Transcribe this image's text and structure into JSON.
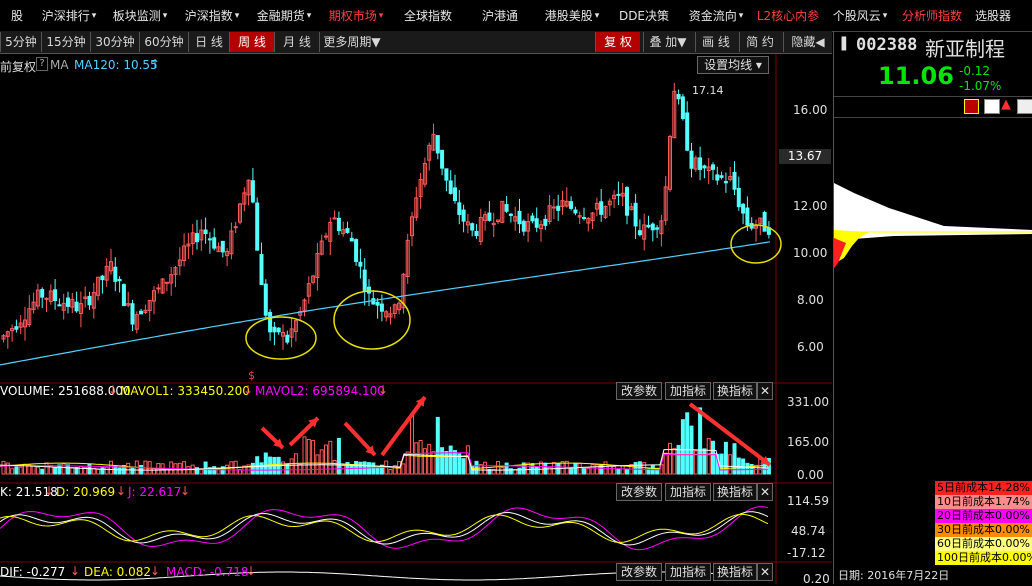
{
  "nav": {
    "items": [
      {
        "label": "股",
        "w": 34
      },
      {
        "label": "沪深排行",
        "w": 70,
        "dd": true
      },
      {
        "label": "板块监测",
        "w": 72,
        "dd": true
      },
      {
        "label": "沪深指数",
        "w": 72,
        "dd": true
      },
      {
        "label": "金融期货",
        "w": 72,
        "dd": true
      },
      {
        "label": "期权市场",
        "w": 72,
        "dd": true,
        "red": true
      },
      {
        "label": "全球指数",
        "w": 72
      },
      {
        "label": "沪港通",
        "w": 72
      },
      {
        "label": "港股美股",
        "w": 72,
        "dd": true
      },
      {
        "label": "DDE决策",
        "w": 72
      },
      {
        "label": "资金流向",
        "w": 72,
        "dd": true
      },
      {
        "label": "L2核心内参",
        "w": 72,
        "red": true
      },
      {
        "label": "个股风云",
        "w": 72,
        "dd": true
      },
      {
        "label": "分析师指数",
        "w": 72,
        "red": true
      },
      {
        "label": "选股器",
        "w": 50
      }
    ]
  },
  "periods": [
    "5分钟",
    "15分钟",
    "30分钟",
    "60分钟",
    "日 线",
    "周 线",
    "月 线",
    "更多周期▼"
  ],
  "active_period": "周 线",
  "tools": [
    "复 权",
    "叠 加▼",
    "画 线",
    "简 约",
    "隐藏◀"
  ],
  "main": {
    "indicator_prefix": "前复权",
    "help": "?",
    "ma_label": "MA",
    "ma120": "MA120: 10.55",
    "setting": "设置均线 ▾",
    "high_mark": "17.14",
    "low_mark": "$",
    "price_ticks": [
      "16.00",
      "13.67",
      "12.00",
      "10.00",
      "8.00",
      "6.00"
    ]
  },
  "volume": {
    "vol": "VOLUME: 251688.000",
    "mavol1": "MAVOL1: 333450.200",
    "mavol2": "MAVOL2: 695894.100",
    "ticks": [
      "331.00",
      "165.00",
      "0.00"
    ]
  },
  "kdj": {
    "k": "K: 21.518",
    "d": "D: 20.969",
    "j": "J: 22.617",
    "ticks": [
      "114.59",
      "48.74",
      "-17.12"
    ]
  },
  "macd": {
    "dif": "DIF: -0.277",
    "dea": "DEA: 0.082",
    "macd": "MACD: -0.718",
    "ticks": [
      "0.20"
    ]
  },
  "panel_buttons": [
    "改参数",
    "加指标",
    "换指标",
    "✕"
  ],
  "stock": {
    "code": "002388",
    "name": "新亚制程",
    "price": "11.06",
    "change": "-0.12",
    "pct": "-1.07%"
  },
  "cost": [
    {
      "label": "5日前成本14.28%",
      "bg": "#ff2020",
      "fg": "#000"
    },
    {
      "label": "10日前成本1.74%",
      "bg": "#ff8c8c",
      "fg": "#000"
    },
    {
      "label": "20日前成本0.00%",
      "bg": "#ff00ff",
      "fg": "#000"
    },
    {
      "label": "30日前成本0.00%",
      "bg": "#ff8c00",
      "fg": "#000"
    },
    {
      "label": "60日前成本0.00%",
      "bg": "#ffff80",
      "fg": "#000"
    },
    {
      "label": "100日前成本0.00%",
      "bg": "#ffff00",
      "fg": "#000"
    }
  ],
  "date_label": "日期: 2016年7月22日",
  "colors": {
    "up": "#ff5a5a",
    "down": "#54ffff",
    "ma": "#54d0ff",
    "yellow": "#ffff00",
    "magenta": "#ff00ff",
    "white": "#ffffff",
    "annot": "#ff3030"
  }
}
